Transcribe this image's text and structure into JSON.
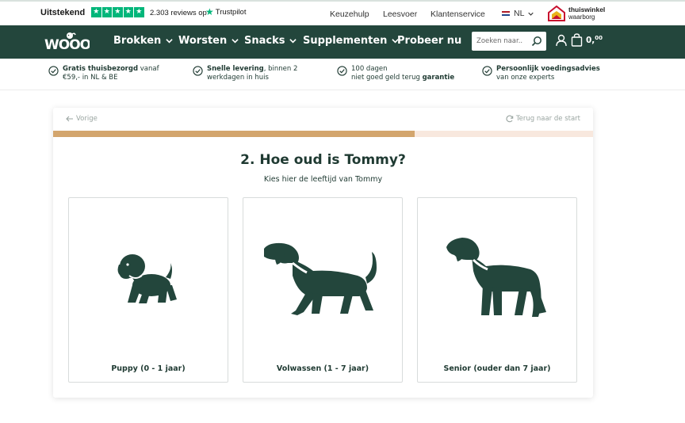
{
  "trustpilot": {
    "rating_label": "Uitstekend",
    "stars": 5,
    "reviews_text": "2.303 reviews op",
    "brand": "Trustpilot",
    "color": "#00b67a"
  },
  "top_links": [
    "Keuzehulp",
    "Leesvoer",
    "Klantenservice"
  ],
  "language": {
    "code": "NL",
    "flag_icon": "dutch-flag-icon"
  },
  "thuiswinkel": {
    "line1": "thuiswinkel",
    "line2": "waarborg"
  },
  "brand": {
    "name": "WOOOF",
    "primary_color": "#23463c",
    "accent_color": "#d3a56d"
  },
  "nav": {
    "items": [
      {
        "label": "Brokken",
        "dropdown": true
      },
      {
        "label": "Worsten",
        "dropdown": true
      },
      {
        "label": "Snacks",
        "dropdown": true
      },
      {
        "label": "Supplementen",
        "dropdown": true
      },
      {
        "label": "Probeer nu",
        "dropdown": false
      }
    ]
  },
  "search": {
    "placeholder": "Zoeken naar..",
    "icon": "search-icon"
  },
  "cart": {
    "total_main": "0,",
    "total_cents": "00"
  },
  "usps": [
    {
      "bold": "Gratis thuisbezorgd",
      "rest": " vanaf",
      "line2": "€59,- in NL & BE"
    },
    {
      "bold": "Snelle levering",
      "rest": ", binnen 2",
      "line2": "werkdagen in huis"
    },
    {
      "line1": "100 dagen",
      "line2_pre": "niet goed geld terug ",
      "line2_bold": "garantie"
    },
    {
      "bold": "Persoonlijk voedingsadvies",
      "line2": "van onze experts"
    }
  ],
  "quiz": {
    "prev_label": "Vorige",
    "restart_label": "Terug naar de start",
    "progress": 0.67,
    "question": "2. Hoe oud is Tommy?",
    "subtitle": "Kies hier de leeftijd van Tommy",
    "options": [
      {
        "label": "Puppy (0 - 1 jaar)",
        "icon": "puppy-icon"
      },
      {
        "label": "Volwassen (1 - 7 jaar)",
        "icon": "adult-dog-icon"
      },
      {
        "label": "Senior (ouder dan 7 jaar)",
        "icon": "senior-dog-icon"
      }
    ]
  }
}
